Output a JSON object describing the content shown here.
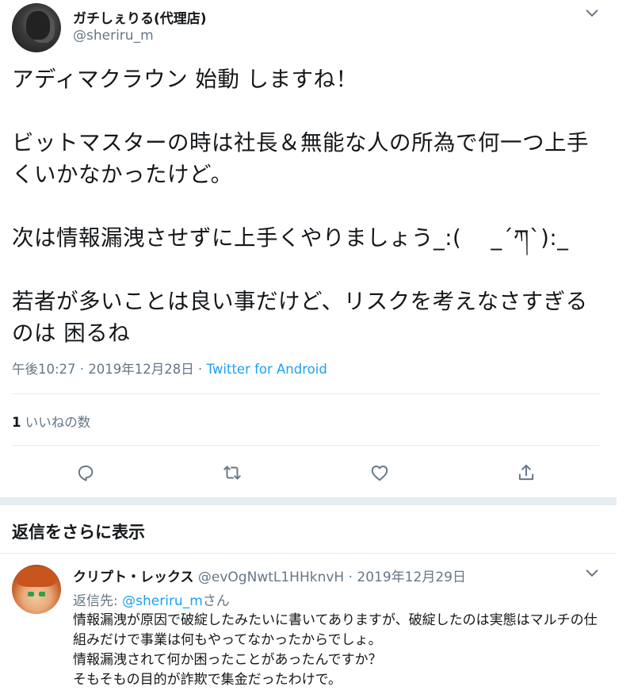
{
  "tweet": {
    "display_name": "ガチしぇりる(代理店)",
    "username": "@sheriru_m",
    "text": "アディマクラウン 始動 しますね！\n\nビットマスターの時は社長＆無能な人の所為で何一つ上手くいかなかったけど。\n\n次は情報漏洩させずに上手くやりましょう_:(　 _´ཀ`):_\n\n若者が多いことは良い事だけど、リスクを考えなさすぎるのは 困るね",
    "time": "午後10:27",
    "date": "2019年12月28日",
    "separator": " · ",
    "source": "Twitter for Android",
    "like_count": "1",
    "like_label": "いいねの数"
  },
  "icons": {
    "caret": "chevron-down-icon",
    "reply": "reply-icon",
    "retweet": "retweet-icon",
    "like": "heart-icon",
    "share": "share-icon"
  },
  "more_replies": "返信をさらに表示",
  "reply": {
    "display_name": "クリプト・レックス",
    "username": "@evOgNwtL1HHknvH",
    "date": "2019年12月29日",
    "reply_to_label": "返信先: ",
    "reply_to_user": "@sheriru_m",
    "reply_to_suffix": "さん",
    "text": "情報漏洩が原因で破綻したみたいに書いてありますが、破綻したのは実態はマルチの仕組みだけで事業は何もやってなかったからでしょ。\n情報漏洩されて何か困ったことがあったんですか？\nそもそもの目的が詐欺で集金だったわけで。"
  },
  "colors": {
    "text": "#14171a",
    "secondary": "#657786",
    "link": "#1da1f2",
    "divider": "#e6ecf0"
  }
}
